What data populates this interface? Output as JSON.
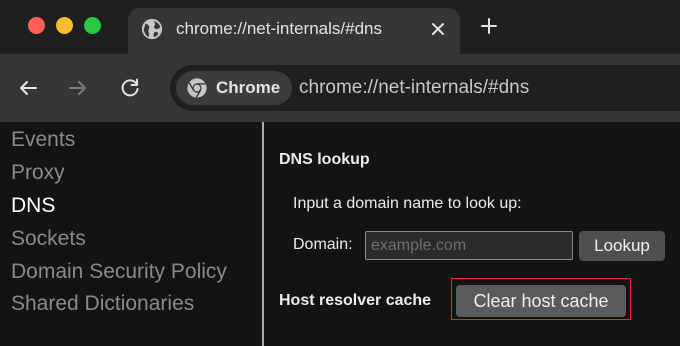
{
  "colors": {
    "traffic_close": "#ff5f57",
    "traffic_minimize": "#febc2e",
    "traffic_maximize": "#28c840",
    "highlight": "#d9302c",
    "sidebar_active": "#ffffff",
    "sidebar_inactive": "#8a8a8a"
  },
  "tab": {
    "title": "chrome://net-internals/#dns",
    "favicon": "globe-icon"
  },
  "toolbar": {
    "site_chip_label": "Chrome",
    "url": "chrome://net-internals/#dns"
  },
  "sidebar": {
    "items": [
      {
        "label": "Events"
      },
      {
        "label": "Proxy"
      },
      {
        "label": "DNS",
        "active": true
      },
      {
        "label": "Sockets"
      },
      {
        "label": "Domain Security Policy"
      },
      {
        "label": "Shared Dictionaries"
      }
    ]
  },
  "dns": {
    "section_title": "DNS lookup",
    "instructions": "Input a domain name to look up:",
    "domain_label": "Domain:",
    "domain_placeholder": "example.com",
    "domain_value": "",
    "lookup_button": "Lookup",
    "cache_label": "Host resolver cache",
    "clear_cache_button": "Clear host cache"
  }
}
